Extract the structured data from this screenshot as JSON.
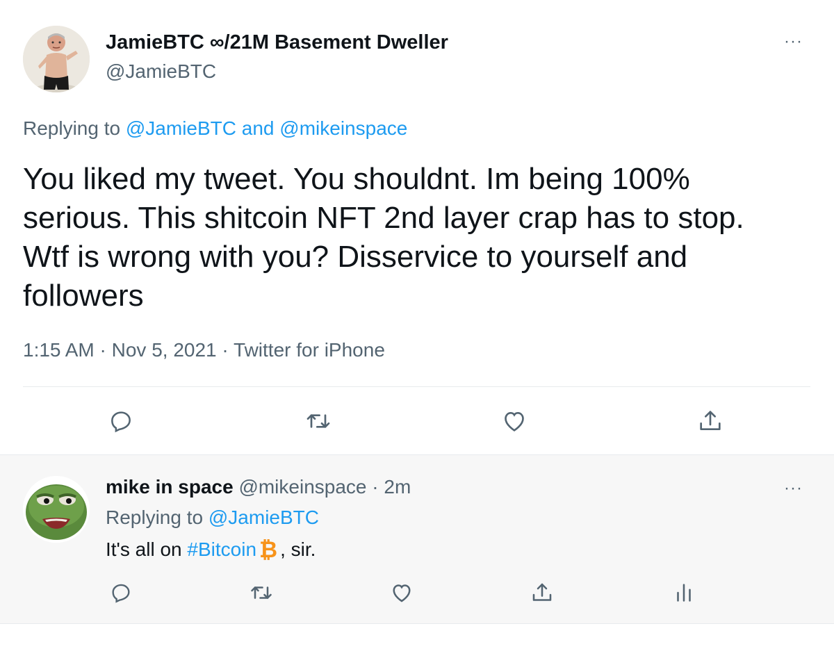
{
  "main_tweet": {
    "display_name": "JamieBTC ∞/21M Basement Dweller",
    "handle": "@JamieBTC",
    "replying_prefix": "Replying to ",
    "replying_to_1": "@JamieBTC",
    "replying_and": " and ",
    "replying_to_2": "@mikeinspace",
    "text": "You liked my tweet. You shouldnt. Im being 100% serious. This shitcoin NFT 2nd layer crap has to stop. Wtf is wrong with you? Disservice to yourself and followers",
    "time": "1:15 AM",
    "date": "Nov 5, 2021",
    "source": "Twitter for iPhone",
    "separator": " · ",
    "more": "···"
  },
  "reply_tweet": {
    "display_name": "mike in space",
    "handle": "@mikeinspace",
    "age": "2m",
    "separator": " · ",
    "replying_prefix": "Replying to ",
    "replying_to": "@JamieBTC",
    "text_before": "It's all on ",
    "hashtag": "#Bitcoin",
    "emoji": "₿",
    "text_after": ", sir.",
    "more": "···"
  },
  "icons": {
    "main_actions": [
      "reply-icon",
      "retweet-icon",
      "like-icon",
      "share-icon"
    ],
    "reply_actions": [
      "reply-icon",
      "retweet-icon",
      "like-icon",
      "share-icon",
      "analytics-icon"
    ]
  },
  "colors": {
    "link": "#1d9bf0",
    "secondary_text": "#536471",
    "primary_text": "#0f1419",
    "bitcoin": "#f7931a"
  }
}
